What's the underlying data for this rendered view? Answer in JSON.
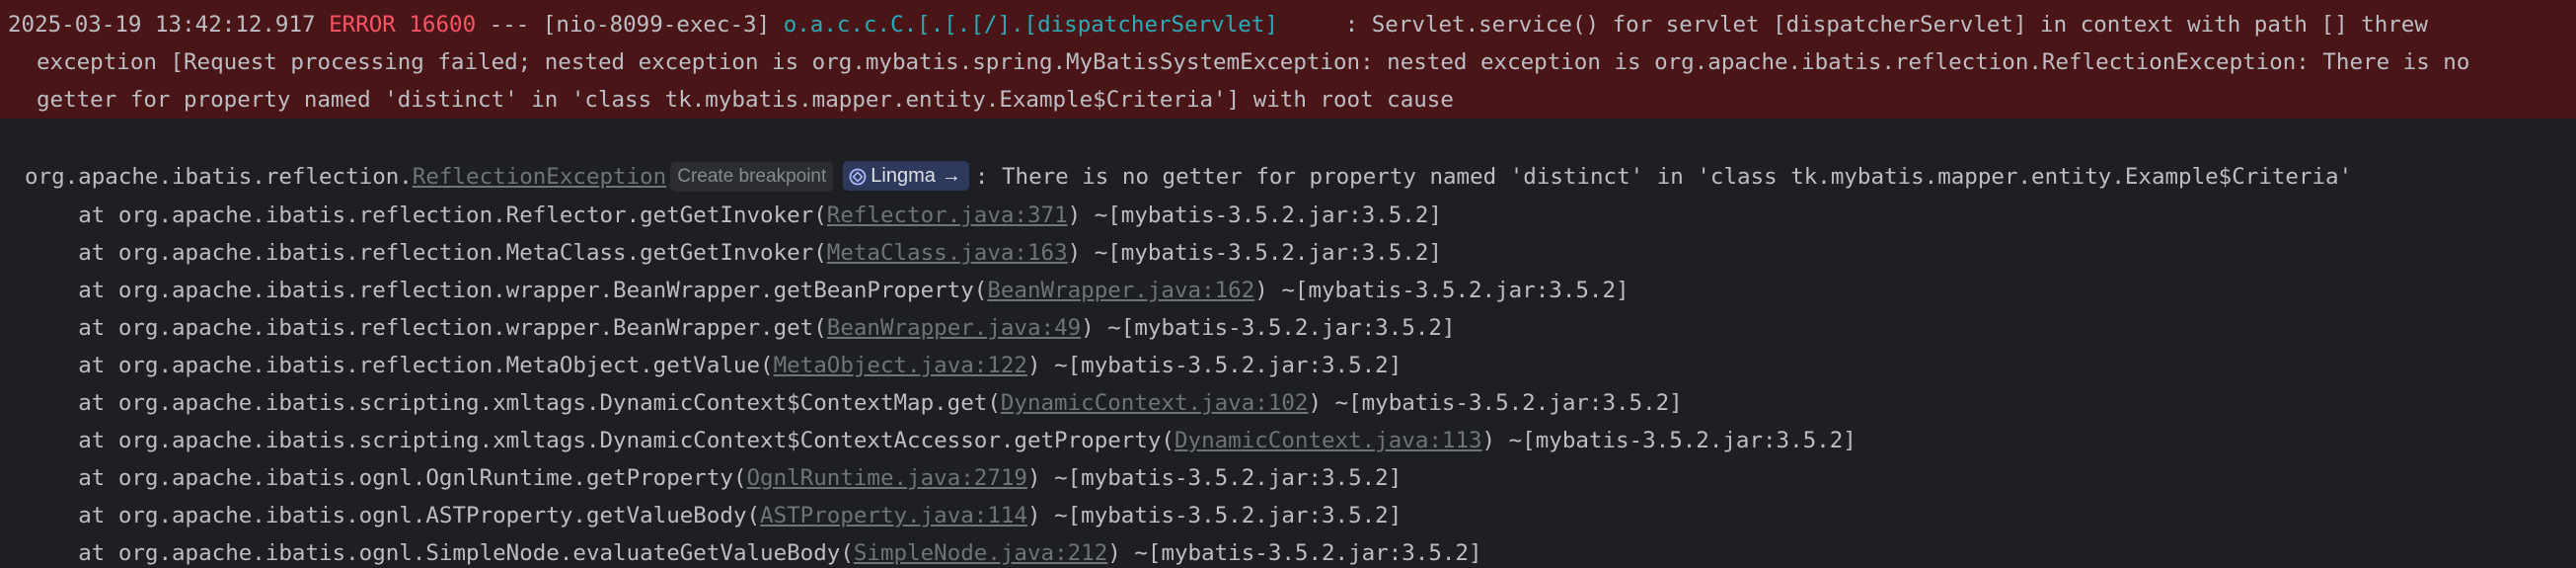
{
  "error_log": {
    "line1": {
      "timestamp": "2025-03-19 13:42:12.917",
      "level": "ERROR",
      "pid": "16600",
      "separator": "---",
      "thread": "[nio-8099-exec-3]",
      "logger": "o.a.c.c.C.[.[.[/].[dispatcherServlet]",
      "message": ": Servlet.service() for servlet [dispatcherServlet] in context with path [] threw"
    },
    "line2": "exception [Request processing failed; nested exception is org.mybatis.spring.MyBatisSystemException: nested exception is org.apache.ibatis.reflection.ReflectionException: There is no",
    "line3": "getter for property named 'distinct' in 'class tk.mybatis.mapper.entity.Example$Criteria'] with root cause"
  },
  "exception": {
    "package": "org.apache.ibatis.reflection.",
    "class_name": "ReflectionException",
    "create_breakpoint_label": "Create breakpoint",
    "lingma_label": "Lingma",
    "lingma_arrow": "→",
    "lingma_icon": "lingma-logo-icon",
    "message": ": There is no getter for property named 'distinct' in 'class tk.mybatis.mapper.entity.Example$Criteria'"
  },
  "stack_frames": [
    {
      "prefix": "at org.apache.ibatis.reflection.Reflector.getGetInvoker(",
      "file": "Reflector.java:371",
      "suffix": ") ~[mybatis-3.5.2.jar:3.5.2]"
    },
    {
      "prefix": "at org.apache.ibatis.reflection.MetaClass.getGetInvoker(",
      "file": "MetaClass.java:163",
      "suffix": ") ~[mybatis-3.5.2.jar:3.5.2]"
    },
    {
      "prefix": "at org.apache.ibatis.reflection.wrapper.BeanWrapper.getBeanProperty(",
      "file": "BeanWrapper.java:162",
      "suffix": ") ~[mybatis-3.5.2.jar:3.5.2]"
    },
    {
      "prefix": "at org.apache.ibatis.reflection.wrapper.BeanWrapper.get(",
      "file": "BeanWrapper.java:49",
      "suffix": ") ~[mybatis-3.5.2.jar:3.5.2]"
    },
    {
      "prefix": "at org.apache.ibatis.reflection.MetaObject.getValue(",
      "file": "MetaObject.java:122",
      "suffix": ") ~[mybatis-3.5.2.jar:3.5.2]"
    },
    {
      "prefix": "at org.apache.ibatis.scripting.xmltags.DynamicContext$ContextMap.get(",
      "file": "DynamicContext.java:102",
      "suffix": ") ~[mybatis-3.5.2.jar:3.5.2]"
    },
    {
      "prefix": "at org.apache.ibatis.scripting.xmltags.DynamicContext$ContextAccessor.getProperty(",
      "file": "DynamicContext.java:113",
      "suffix": ") ~[mybatis-3.5.2.jar:3.5.2]"
    },
    {
      "prefix": "at org.apache.ibatis.ognl.OgnlRuntime.getProperty(",
      "file": "OgnlRuntime.java:2719",
      "suffix": ") ~[mybatis-3.5.2.jar:3.5.2]"
    },
    {
      "prefix": "at org.apache.ibatis.ognl.ASTProperty.getValueBody(",
      "file": "ASTProperty.java:114",
      "suffix": ") ~[mybatis-3.5.2.jar:3.5.2]"
    },
    {
      "prefix": "at org.apache.ibatis.ognl.SimpleNode.evaluateGetValueBody(",
      "file": "SimpleNode.java:212",
      "suffix": ") ~[mybatis-3.5.2.jar:3.5.2]"
    }
  ],
  "colors": {
    "background": "#1e1f22",
    "error_highlight": "#4a1517",
    "error_red": "#f75464",
    "logger_teal": "#2aacb8",
    "default_text": "#bcbec4",
    "link_gray": "#6f737a"
  }
}
